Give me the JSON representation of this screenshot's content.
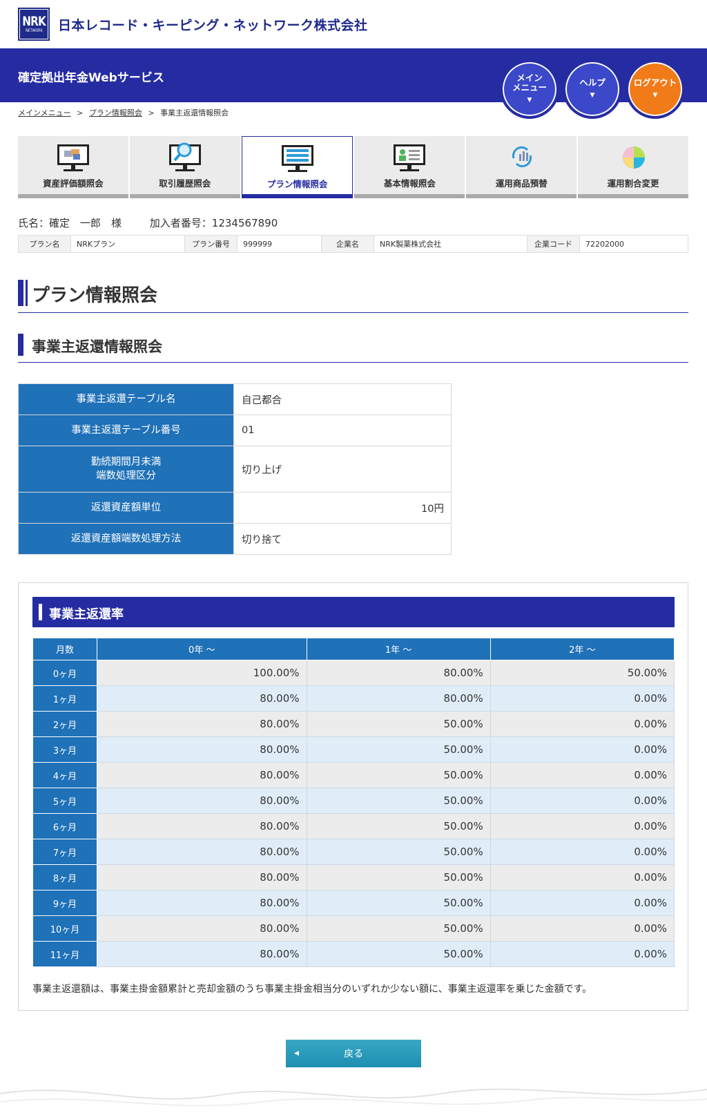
{
  "header": {
    "logo_text": "NRK",
    "logo_sub": "NETWORK",
    "company": "日本レコード・キーピング・ネットワーク株式会社",
    "service": "確定拠出年金Webサービス",
    "buttons": {
      "main_menu_l1": "メイン",
      "main_menu_l2": "メニュー",
      "help": "ヘルプ",
      "logout": "ログアウト",
      "arrow": "▼"
    }
  },
  "breadcrumb": {
    "items": [
      "メインメニュー",
      "プラン情報照会",
      "事業主返還情報照会"
    ],
    "sep": ">"
  },
  "tabs": [
    {
      "label": "資産評価額照会",
      "icon": "asset-monitor-icon"
    },
    {
      "label": "取引履歴照会",
      "icon": "magnifier-monitor-icon"
    },
    {
      "label": "プラン情報照会",
      "icon": "list-monitor-icon",
      "active": true
    },
    {
      "label": "基本情報照会",
      "icon": "profile-monitor-icon"
    },
    {
      "label": "運用商品預替",
      "icon": "refresh-chart-icon"
    },
    {
      "label": "運用割合変更",
      "icon": "pie-chart-icon"
    }
  ],
  "user": {
    "name": "氏名：確定　一郎　様",
    "member": "加入者番号：1234567890"
  },
  "plan": {
    "plan_name_key": "プラン名",
    "plan_name": "NRKプラン",
    "plan_no_key": "プラン番号",
    "plan_no": "999999",
    "company_key": "企業名",
    "company": "NRK製薬株式会社",
    "code_key": "企業コード",
    "code": "72202000"
  },
  "page_title": "プラン情報照会",
  "section_title": "事業主返還情報照会",
  "info": {
    "r1k": "事業主返還テーブル名",
    "r1v": "自己都合",
    "r2k": "事業主返還テーブル番号",
    "r2v": "01",
    "r3k1": "勤続期間月未満",
    "r3k2": "端数処理区分",
    "r3v": "切り上げ",
    "r4k": "返還資産額単位",
    "r4v": "10円",
    "r5k": "返還資産額端数処理方法",
    "r5v": "切り捨て"
  },
  "rates": {
    "title": "事業主返還率",
    "headers": [
      "月数",
      "0年 〜",
      "1年 〜",
      "2年 〜"
    ],
    "rows": [
      [
        "0ヶ月",
        "100.00%",
        "80.00%",
        "50.00%"
      ],
      [
        "1ヶ月",
        "80.00%",
        "80.00%",
        "0.00%"
      ],
      [
        "2ヶ月",
        "80.00%",
        "50.00%",
        "0.00%"
      ],
      [
        "3ヶ月",
        "80.00%",
        "50.00%",
        "0.00%"
      ],
      [
        "4ヶ月",
        "80.00%",
        "50.00%",
        "0.00%"
      ],
      [
        "5ヶ月",
        "80.00%",
        "50.00%",
        "0.00%"
      ],
      [
        "6ヶ月",
        "80.00%",
        "50.00%",
        "0.00%"
      ],
      [
        "7ヶ月",
        "80.00%",
        "50.00%",
        "0.00%"
      ],
      [
        "8ヶ月",
        "80.00%",
        "50.00%",
        "0.00%"
      ],
      [
        "9ヶ月",
        "80.00%",
        "50.00%",
        "0.00%"
      ],
      [
        "10ヶ月",
        "80.00%",
        "50.00%",
        "0.00%"
      ],
      [
        "11ヶ月",
        "80.00%",
        "50.00%",
        "0.00%"
      ]
    ],
    "note": "事業主返還額は、事業主掛金額累計と売却金額のうち事業主掛金相当分のいずれか少ない額に、事業主返還率を乗じた金額です。"
  },
  "back_label": "戻る",
  "back_icon": "◀"
}
